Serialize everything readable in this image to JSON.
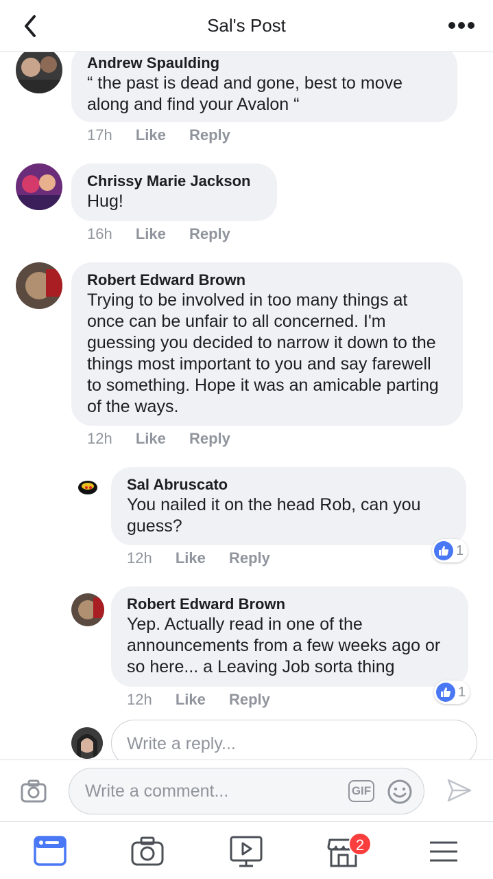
{
  "header": {
    "title": "Sal's Post"
  },
  "comments": [
    {
      "author": "Andrew Spaulding",
      "text": "“ the past is dead and gone, best to move along and find your Avalon “",
      "time": "17h",
      "like": "Like",
      "reply": "Reply"
    },
    {
      "author": "Chrissy Marie Jackson",
      "text": "Hug!",
      "time": "16h",
      "like": "Like",
      "reply": "Reply"
    },
    {
      "author": "Robert Edward Brown",
      "text": "Trying to be involved in too many things at once can be unfair to all concerned. I'm guessing you decided to narrow it down to the things most important to you and say farewell to something. Hope it was an amicable parting of the ways.",
      "time": "12h",
      "like": "Like",
      "reply": "Reply"
    }
  ],
  "replies": [
    {
      "author": "Sal Abruscato",
      "text": "You nailed it on the head Rob, can you guess?",
      "time": "12h",
      "like": "Like",
      "reply": "Reply",
      "reaction_count": "1"
    },
    {
      "author": "Robert Edward Brown",
      "text": "Yep. Actually read in one of the announcements from a few weeks ago or so here... a Leaving Job sorta thing",
      "time": "12h",
      "like": "Like",
      "reply": "Reply",
      "reaction_count": "1"
    }
  ],
  "reply_input": {
    "placeholder": "Write a reply..."
  },
  "composer": {
    "placeholder": "Write a comment...",
    "gif_label": "GIF"
  },
  "tabbar": {
    "marketplace_badge": "2"
  },
  "colors": {
    "accent": "#4a78f5",
    "bubble": "#f0f1f4",
    "meta": "#90949c",
    "badge": "#fa3e3e"
  }
}
